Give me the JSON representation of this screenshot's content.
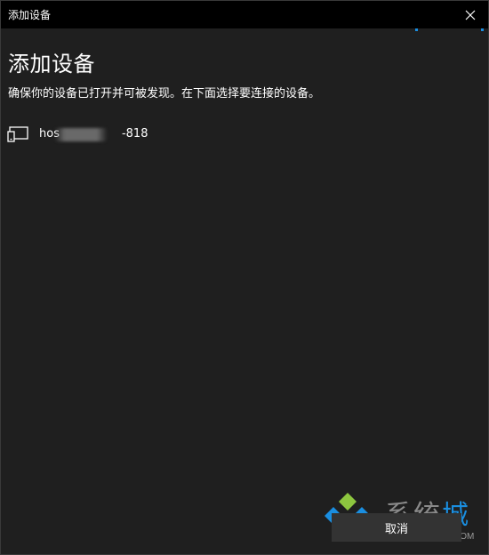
{
  "window": {
    "title": "添加设备",
    "close_icon": "close-icon"
  },
  "main": {
    "heading": "添加设备",
    "subtitle": "确保你的设备已打开并可被发现。在下面选择要连接的设备。"
  },
  "devices": [
    {
      "icon": "display-device-icon",
      "name_prefix": "hos",
      "name_suffix": "-818"
    }
  ],
  "footer": {
    "cancel_label": "取消"
  },
  "watermark": {
    "text_main": "系统",
    "text_accent": "城",
    "text_sub": "XITONGCHENG.COM"
  },
  "colors": {
    "accent": "#1a8ee0",
    "background": "#1f1f1f",
    "titlebar": "#000000",
    "button": "#333333"
  }
}
